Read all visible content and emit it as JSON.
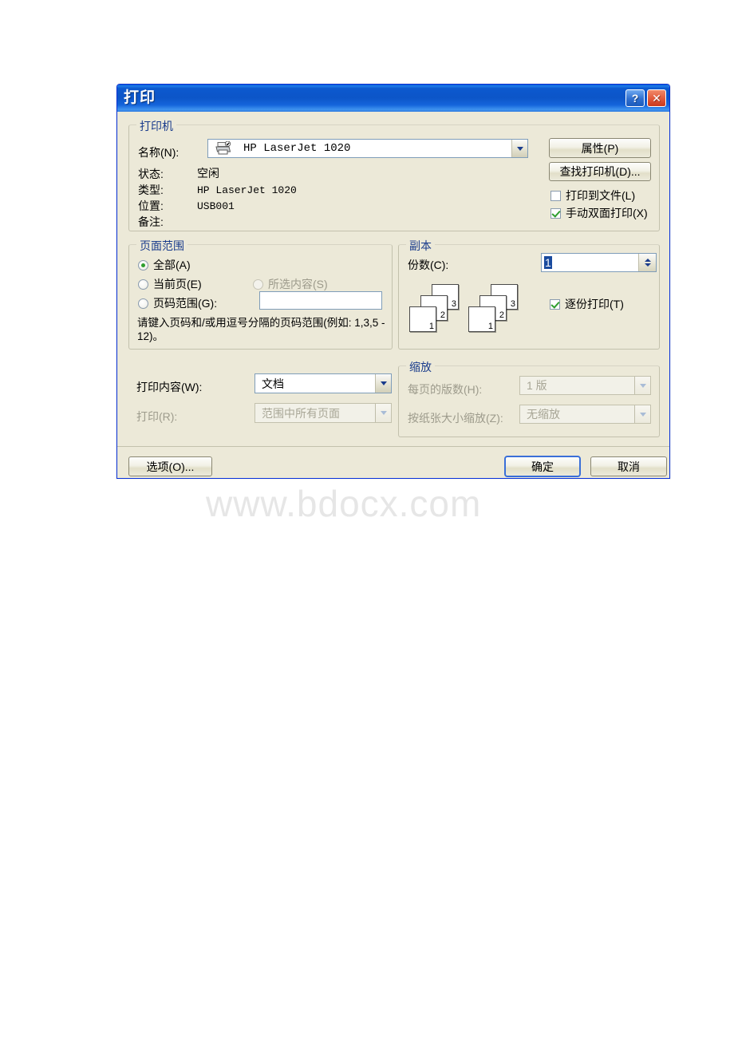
{
  "window": {
    "title": "打印",
    "help_button": "?",
    "close_button": "✕"
  },
  "printer_group": {
    "legend": "打印机",
    "name_label": "名称(N):",
    "name_value": "HP LaserJet 1020",
    "properties_button": "属性(P)",
    "find_printer_button": "查找打印机(D)...",
    "status_label": "状态:",
    "status_value": "空闲",
    "type_label": "类型:",
    "type_value": "HP LaserJet 1020",
    "location_label": "位置:",
    "location_value": "USB001",
    "comment_label": "备注:",
    "comment_value": "",
    "print_to_file_label": "打印到文件(L)",
    "print_to_file_checked": false,
    "manual_duplex_label": "手动双面打印(X)",
    "manual_duplex_checked": true
  },
  "page_range_group": {
    "legend": "页面范围",
    "option_all": "全部(A)",
    "option_current": "当前页(E)",
    "option_selection": "所选内容(S)",
    "option_pages": "页码范围(G):",
    "pages_value": "",
    "selected": "all",
    "selection_disabled": true,
    "hint": "请键入页码和/或用逗号分隔的页码范围(例如: 1,3,5 - 12)。"
  },
  "copies_group": {
    "legend": "副本",
    "copies_label": "份数(C):",
    "copies_value": "1",
    "collate_label": "逐份打印(T)",
    "collate_checked": true,
    "preview_page_numbers": [
      "3",
      "2",
      "1"
    ]
  },
  "print_what": {
    "content_label": "打印内容(W):",
    "content_value": "文档",
    "print_label": "打印(R):",
    "print_value": "范围中所有页面",
    "print_disabled": true
  },
  "zoom_group": {
    "legend": "缩放",
    "pages_per_sheet_label": "每页的版数(H):",
    "pages_per_sheet_value": "1 版",
    "scale_to_paper_label": "按纸张大小缩放(Z):",
    "scale_to_paper_value": "无缩放",
    "disabled": true
  },
  "footer": {
    "options_button": "选项(O)...",
    "ok_button": "确定",
    "cancel_button": "取消"
  },
  "watermark": {
    "text": "www.bdocx.com"
  },
  "colors": {
    "titlebar_blue": "#0c55c8",
    "dialog_face": "#ece9d8",
    "group_label": "#1a3c8c",
    "radio_dot_green": "#2f9e2f",
    "selection_blue": "#1a4b9e",
    "close_red": "#e2593a"
  }
}
